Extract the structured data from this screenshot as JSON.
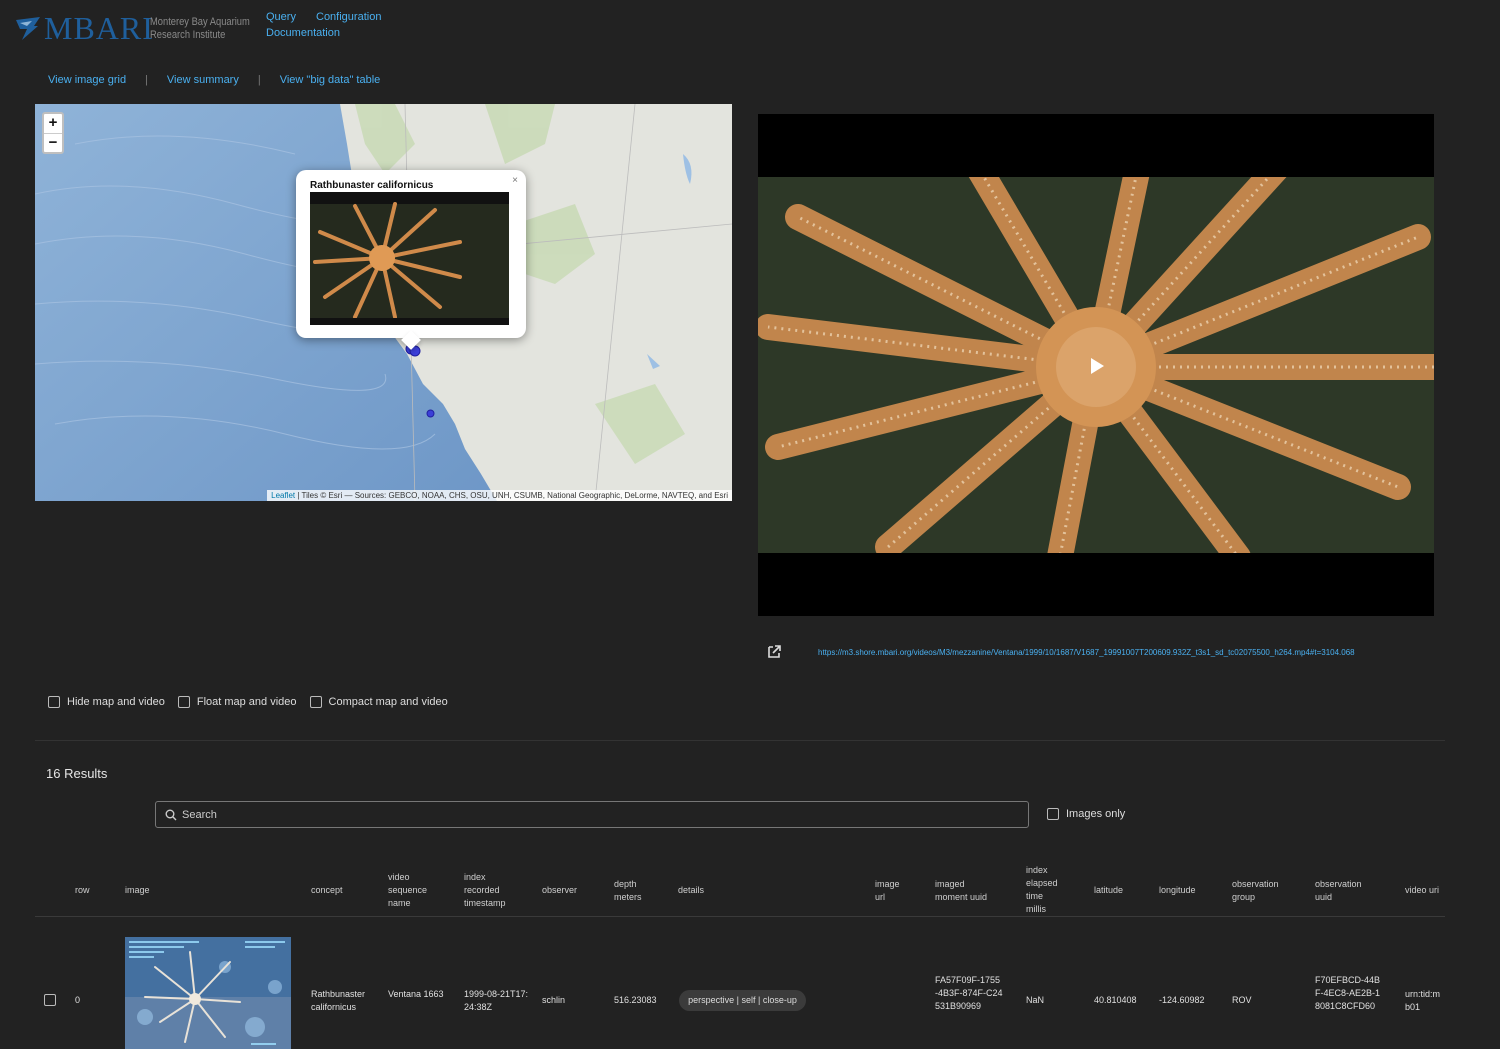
{
  "header": {
    "logo_word": "MBARI",
    "institute_line1": "Monterey Bay Aquarium",
    "institute_line2": "Research Institute",
    "nav": [
      "Query",
      "Configuration",
      "Documentation"
    ]
  },
  "subnav": {
    "items": [
      "View image grid",
      "View summary",
      "View \"big data\" table"
    ],
    "separator": "|"
  },
  "map": {
    "zoom_in": "+",
    "zoom_out": "−",
    "popup_title": "Rathbunaster californicus",
    "popup_close": "×",
    "attribution_leaflet": "Leaflet",
    "attribution_rest": " | Tiles © Esri — Sources: GEBCO, NOAA, CHS, OSU, UNH, CSUMB, National Geographic, DeLorme, NAVTEQ, and Esri"
  },
  "video": {
    "url": "https://m3.shore.mbari.org/videos/M3/mezzanine/Ventana/1999/10/1687/V1687_19991007T200609.932Z_t3s1_sd_tc02075500_h264.mp4#t=3104.068"
  },
  "options": {
    "hide_map": "Hide map and video",
    "float_map": "Float map and video",
    "compact_map": "Compact map and video"
  },
  "results": {
    "count_label": "16 Results",
    "search_placeholder": "Search",
    "images_only": "Images only"
  },
  "table": {
    "headers": {
      "row": "row",
      "image": "image",
      "concept": "concept",
      "video_sequence_name": "video sequence name",
      "index_recorded_timestamp": "index recorded timestamp",
      "observer": "observer",
      "depth_meters": "depth meters",
      "details": "details",
      "image_url": "image url",
      "imaged_moment_uuid": "imaged moment uuid",
      "index_elapsed_time_millis": "index elapsed time millis",
      "latitude": "latitude",
      "longitude": "longitude",
      "observation_group": "observation group",
      "observation_uuid": "observation uuid",
      "video_uri": "video uri"
    },
    "rows": [
      {
        "row": "0",
        "concept": "Rathbunaster californicus",
        "video_sequence_name": "Ventana 1663",
        "index_recorded_timestamp": "1999-08-21T17:24:38Z",
        "observer": "schlin",
        "depth_meters": "516.23083",
        "details": "perspective | self | close-up",
        "imaged_moment_uuid": "FA57F09F-1755-4B3F-874F-C24531B90969",
        "index_elapsed_time_millis": "NaN",
        "latitude": "40.810408",
        "longitude": "-124.60982",
        "observation_group": "ROV",
        "observation_uuid": "F70EFBCD-44BF-4EC8-AE2B-18081C8CFD60",
        "video_uri": "urn:tid:mb01"
      }
    ]
  },
  "colors": {
    "background": "#222222",
    "link": "#4ab0f0",
    "brand": "#1f5f9c"
  }
}
